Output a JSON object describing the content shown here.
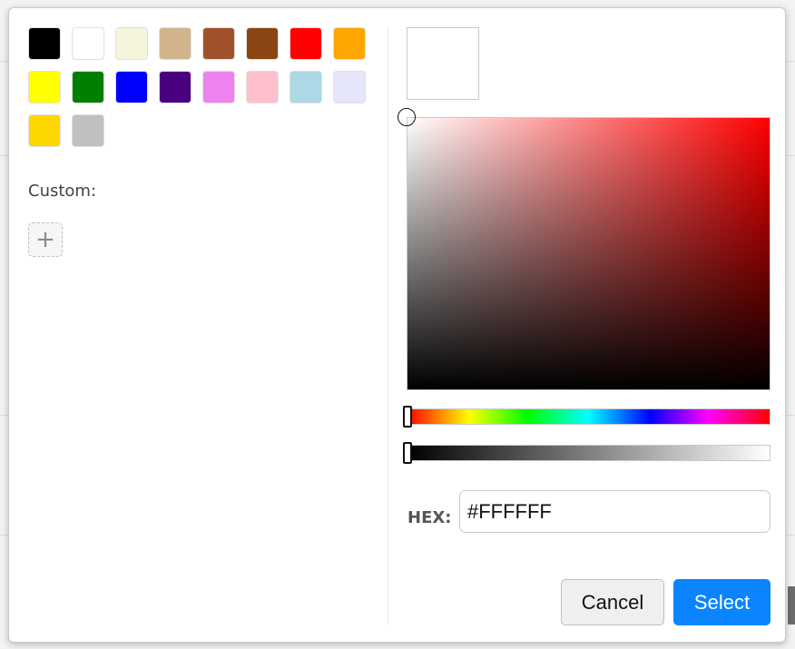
{
  "swatches": [
    {
      "color": "#000000"
    },
    {
      "color": "#FFFFFF"
    },
    {
      "color": "#F5F5DC"
    },
    {
      "color": "#D2B48C"
    },
    {
      "color": "#A0522D"
    },
    {
      "color": "#8B4513"
    },
    {
      "color": "#FF0000"
    },
    {
      "color": "#FFA500"
    },
    {
      "color": "#FFFF00"
    },
    {
      "color": "#008000"
    },
    {
      "color": "#0000FF"
    },
    {
      "color": "#4B0082"
    },
    {
      "color": "#EE82EE"
    },
    {
      "color": "#FFC0CB"
    },
    {
      "color": "#ADD8E6"
    },
    {
      "color": "#E6E6FA"
    },
    {
      "color": "#FFD700"
    },
    {
      "color": "#C0C0C0"
    }
  ],
  "custom": {
    "label": "Custom:",
    "add_symbol": "+"
  },
  "preview": {
    "color": "#FFFFFF"
  },
  "picker": {
    "hue_color": "#FF0000"
  },
  "hex": {
    "label": "HEX:",
    "value": "#FFFFFF"
  },
  "buttons": {
    "cancel": "Cancel",
    "select": "Select"
  },
  "colors": {
    "accent": "#0A84FF"
  }
}
